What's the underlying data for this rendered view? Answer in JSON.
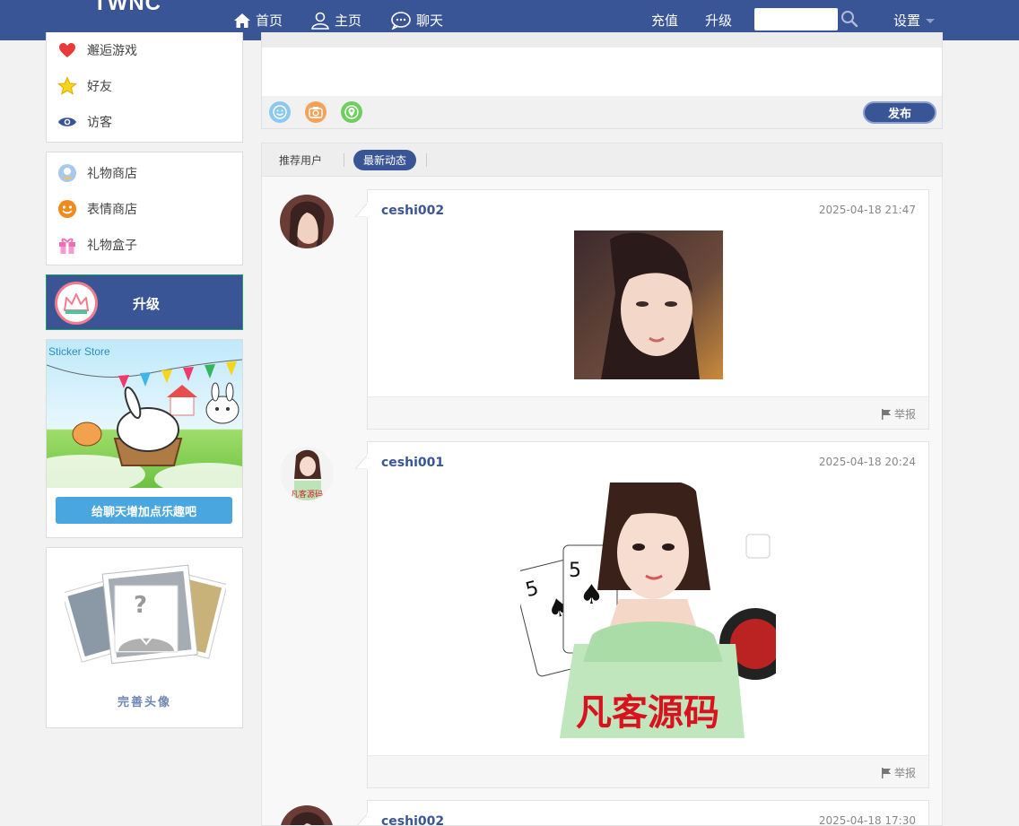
{
  "header": {
    "logo": "TWNC",
    "nav": {
      "home": "首页",
      "main": "主页",
      "chat": "聊天"
    },
    "recharge": "充值",
    "upgrade": "升级",
    "search_placeholder": "",
    "settings": "设置"
  },
  "sidebar": {
    "menu1": [
      {
        "label": "邂逅游戏",
        "icon": "heart-icon"
      },
      {
        "label": "好友",
        "icon": "star-icon"
      },
      {
        "label": "访客",
        "icon": "eye-icon"
      }
    ],
    "menu2": [
      {
        "label": "礼物商店",
        "icon": "gift-shop-icon"
      },
      {
        "label": "表情商店",
        "icon": "smiley-icon"
      },
      {
        "label": "礼物盒子",
        "icon": "gift-box-icon"
      }
    ],
    "upgrade_label": "升级",
    "sticker": {
      "title": "Sticker Store",
      "button": "给聊天增加点乐趣吧"
    },
    "avatar_prompt": "完善头像"
  },
  "composer": {
    "placeholder": "",
    "tools": [
      "emoji-icon",
      "camera-icon",
      "location-icon"
    ],
    "publish": "发布"
  },
  "feed": {
    "tabs": {
      "recommend": "推荐用户",
      "latest": "最新动态"
    },
    "posts": [
      {
        "user": "ceshi002",
        "time": "2025-04-18 21:47",
        "report": "举报"
      },
      {
        "user": "ceshi001",
        "time": "2025-04-18 20:24",
        "image_caption": "凡客源码",
        "report": "举报"
      },
      {
        "user": "ceshi002",
        "time": "2025-04-18 17:30"
      }
    ]
  },
  "colors": {
    "brand": "#3a5596",
    "accent_blue": "#4aa6de",
    "background": "#f2f2f2"
  }
}
